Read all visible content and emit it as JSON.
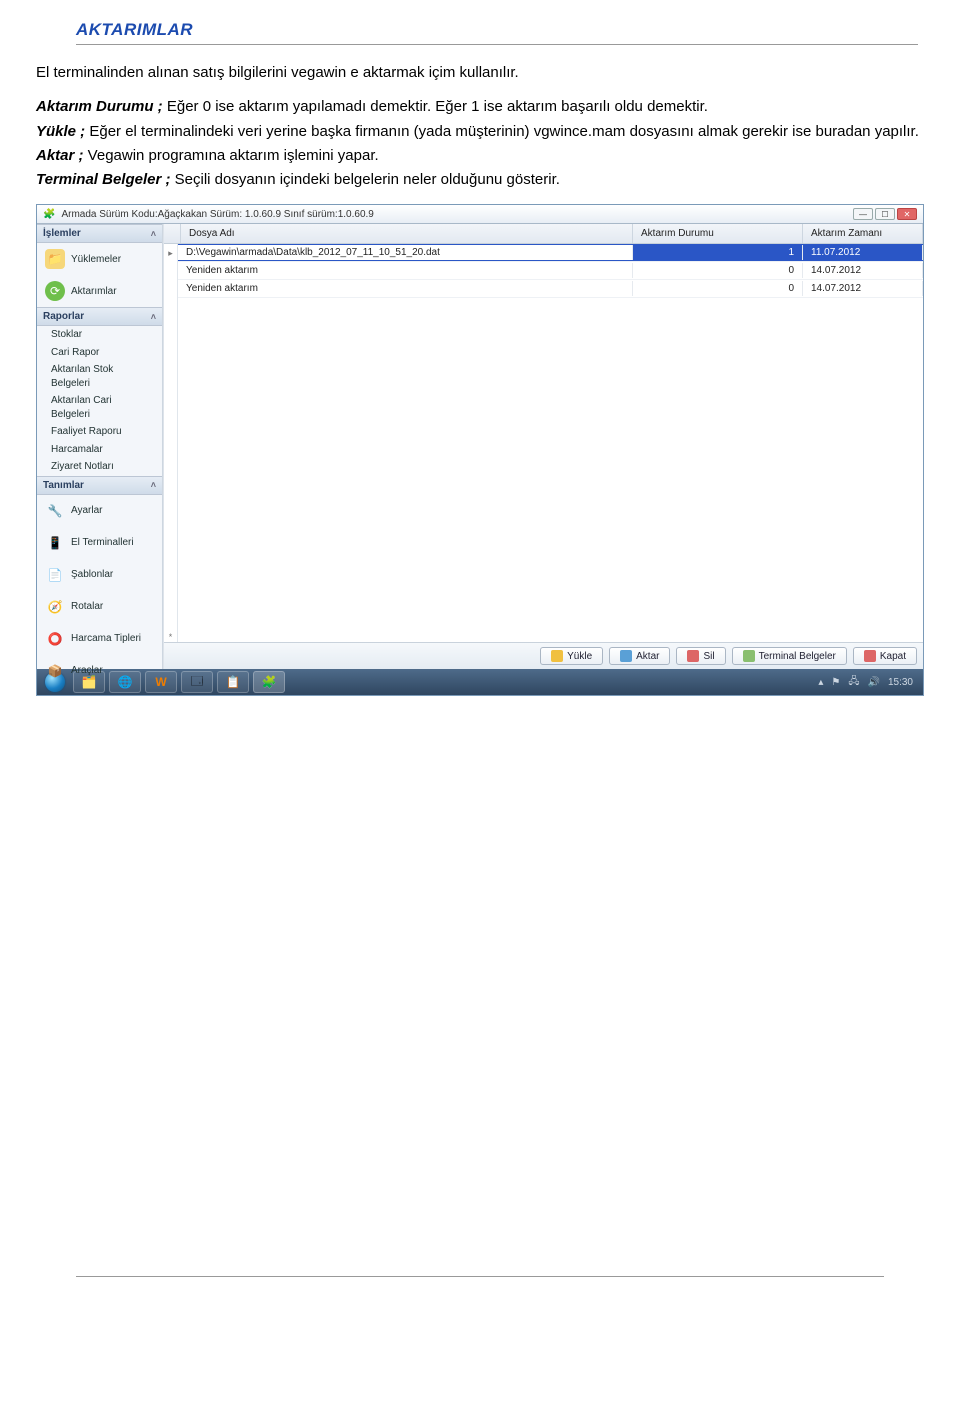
{
  "doc": {
    "title": "AKTARIMLAR",
    "intro": "El terminalinden alınan satış bilgilerini vegawin e aktarmak içim kullanılır.",
    "def1_label": "Aktarım Durumu ;",
    "def1_text": " Eğer 0 ise aktarım yapılamadı demektir. Eğer 1 ise aktarım başarılı oldu demektir.",
    "def2_label": "Yükle ;",
    "def2_text": " Eğer el terminalindeki veri yerine başka firmanın (yada müşterinin) vgwince.mam dosyasını almak gerekir ise buradan yapılır.",
    "def3_label": "Aktar ;",
    "def3_text": " Vegawin programına aktarım işlemini yapar.",
    "def4_label": "Terminal Belgeler ;",
    "def4_text": "  Seçili dosyanın içindeki belgelerin neler olduğunu gösterir."
  },
  "window": {
    "title": "Armada  Sürüm Kodu:Ağaçkakan   Sürüm: 1.0.60.9   Sınıf sürüm:1.0.60.9",
    "nav": {
      "islemler": "İşlemler",
      "yuklemeler": "Yüklemeler",
      "aktarimlar": "Aktarımlar",
      "raporlar": "Raporlar",
      "rapor_items": [
        "Stoklar",
        "Cari Rapor",
        "Aktarılan Stok Belgeleri",
        "Aktarılan Cari Belgeleri",
        "Faaliyet Raporu",
        "Harcamalar",
        "Ziyaret Notları"
      ],
      "tanimlar": "Tanımlar",
      "tanim_items": {
        "ayarlar": "Ayarlar",
        "terminaller": "El Terminalleri",
        "sablonlar": "Şablonlar",
        "rotalar": "Rotalar",
        "harcama": "Harcama Tipleri",
        "araclar": "Araçlar"
      }
    },
    "grid": {
      "col_file": "Dosya Adı",
      "col_status": "Aktarım Durumu",
      "col_time": "Aktarım Zamanı",
      "rows": [
        {
          "file": "D:\\Vegawin\\armada\\Data\\klb_2012_07_11_10_51_20.dat",
          "status": "1",
          "time": "11.07.2012"
        },
        {
          "file": "Yeniden aktarım",
          "status": "0",
          "time": "14.07.2012"
        },
        {
          "file": "Yeniden aktarım",
          "status": "0",
          "time": "14.07.2012"
        }
      ]
    },
    "buttons": {
      "yukle": "Yükle",
      "aktar": "Aktar",
      "sil": "Sil",
      "terminalbelgeler": "Terminal Belgeler",
      "kapat": "Kapat"
    },
    "tray_time": "15:30"
  }
}
